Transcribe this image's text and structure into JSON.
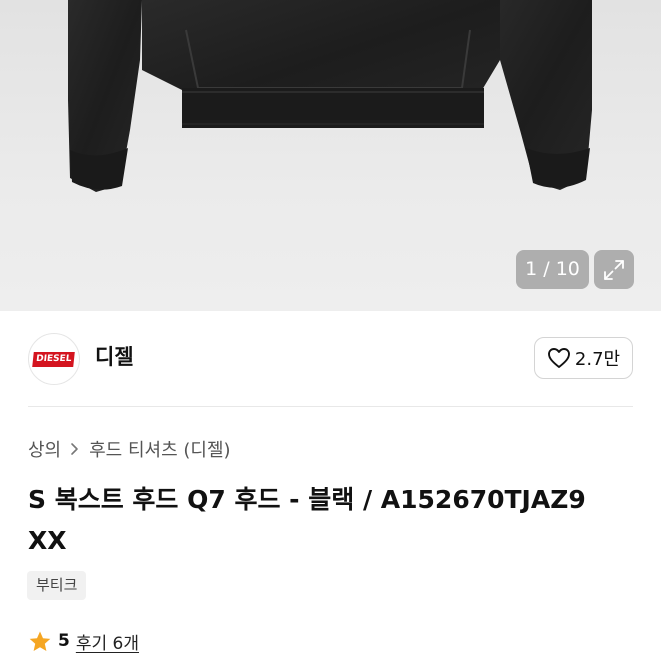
{
  "gallery": {
    "counter": "1 / 10"
  },
  "brand": {
    "logo_text": "DIESEL",
    "name": "디젤",
    "likes": "2.7만"
  },
  "breadcrumb": {
    "items": [
      "상의",
      "후드 티셔츠 (디젤)"
    ]
  },
  "product": {
    "title_line1": "S 복스트 후드 Q7 후드 - 블랙 / A152670TJAZ9",
    "title_line2": "XX",
    "tag": "부티크",
    "rating": "5",
    "reviews": "후기 6개"
  },
  "colors": {
    "accent_red": "#d4141f",
    "star": "#f5a623"
  }
}
